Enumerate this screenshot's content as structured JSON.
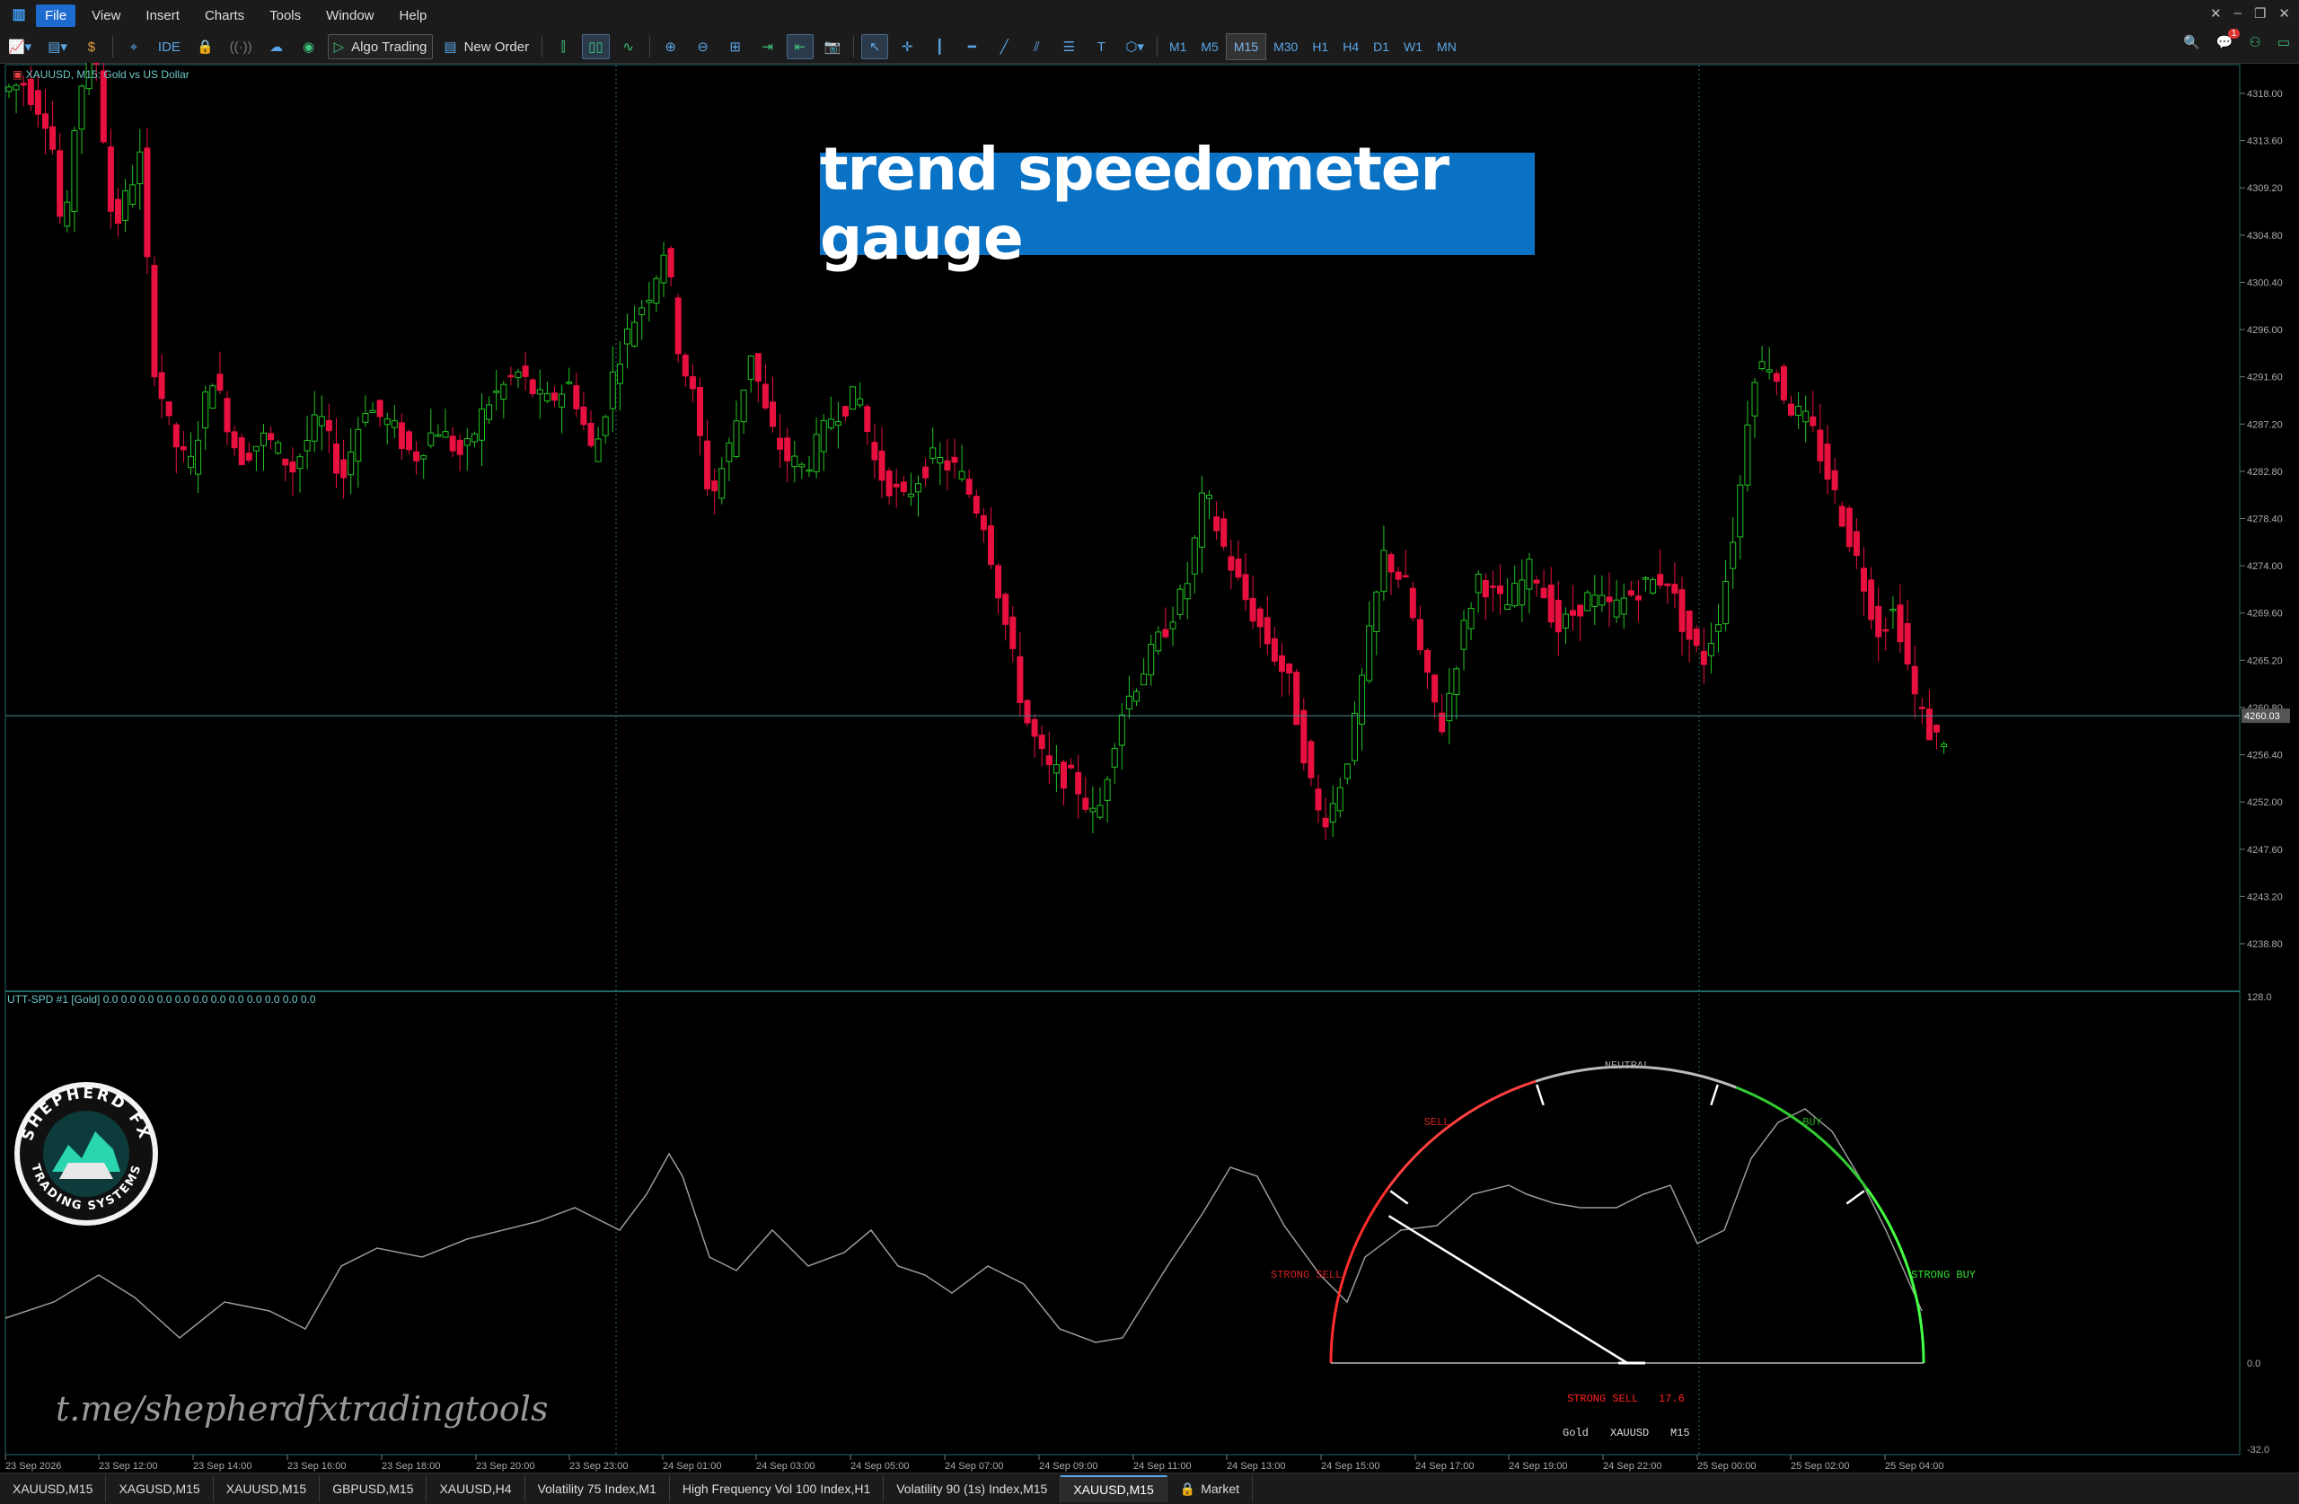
{
  "menu": {
    "items": [
      {
        "label": "File",
        "active": true
      },
      {
        "label": "View"
      },
      {
        "label": "Insert"
      },
      {
        "label": "Charts"
      },
      {
        "label": "Tools"
      },
      {
        "label": "Window"
      },
      {
        "label": "Help"
      }
    ]
  },
  "toolbar": {
    "ide_label": "IDE",
    "algo_trading_label": "Algo Trading",
    "new_order_label": "New Order",
    "timeframes": [
      "M1",
      "M5",
      "M15",
      "M30",
      "H1",
      "H4",
      "D1",
      "W1",
      "MN"
    ],
    "selected_timeframe": "M15",
    "notification_count": "1"
  },
  "chart": {
    "symbol_label": "XAUUSD, M15:  Gold vs US Dollar",
    "price_ticks": [
      "4318.00",
      "4313.60",
      "4309.20",
      "4304.80",
      "4300.40",
      "4296.00",
      "4291.60",
      "4287.20",
      "4282.80",
      "4278.40",
      "4274.00",
      "4269.60",
      "4265.20",
      "4260.80",
      "4256.40",
      "4252.00",
      "4247.60",
      "4243.20",
      "4238.80"
    ],
    "current_price": "4260.03",
    "time_ticks": [
      "23 Sep 2026",
      "23 Sep 12:00",
      "23 Sep 14:00",
      "23 Sep 16:00",
      "23 Sep 18:00",
      "23 Sep 20:00",
      "23 Sep 23:00",
      "24 Sep 01:00",
      "24 Sep 03:00",
      "24 Sep 05:00",
      "24 Sep 07:00",
      "24 Sep 09:00",
      "24 Sep 11:00",
      "24 Sep 13:00",
      "24 Sep 15:00",
      "24 Sep 17:00",
      "24 Sep 19:00",
      "24 Sep 22:00",
      "25 Sep 00:00",
      "25 Sep 02:00",
      "25 Sep 04:00"
    ],
    "colors": {
      "bull": "#22c422",
      "bear": "#e8103f",
      "grid": "#2a6a6a",
      "axis_text": "#aaaaaa"
    }
  },
  "banner": {
    "text": "trend speedometer gauge"
  },
  "indicator": {
    "label": "UTT-SPD #1 [Gold] 0.0 0.0 0.0 0.0 0.0 0.0 0.0 0.0 0.0 0.0 0.0 0.0",
    "axis_ticks": [
      "128.0",
      "0.0",
      "-32.0"
    ],
    "gauge": {
      "zone_labels": {
        "neutral": "NEUTRAL",
        "sell": "SELL",
        "buy": "BUY",
        "strong_sell": "STRONG SELL",
        "strong_buy": "STRONG BUY"
      },
      "reading_label": "STRONG SELL",
      "reading_value": "17.6",
      "info": [
        "Gold",
        "XAUUSD",
        "M15"
      ],
      "colors": {
        "strong_sell": "#ff2d2d",
        "sell": "#ff4040",
        "neutral": "#bbbbbb",
        "buy": "#33cc33",
        "strong_buy": "#44ff44"
      }
    }
  },
  "logo": {
    "top_text": "SHEPHERD FX",
    "bottom_text": "TRADING SYSTEMS"
  },
  "telegram_link": "t.me/shepherdfxtradingtools",
  "tabs": [
    {
      "label": "XAUUSD,M15"
    },
    {
      "label": "XAGUSD,M15"
    },
    {
      "label": "XAUUSD,M15"
    },
    {
      "label": "GBPUSD,M15"
    },
    {
      "label": "XAUUSD,H4"
    },
    {
      "label": "Volatility 75 Index,M1"
    },
    {
      "label": "High Frequency Vol 100 Index,H1"
    },
    {
      "label": "Volatility 90 (1s) Index,M15"
    },
    {
      "label": "XAUUSD,M15",
      "active": true
    },
    {
      "label": "Market"
    }
  ]
}
